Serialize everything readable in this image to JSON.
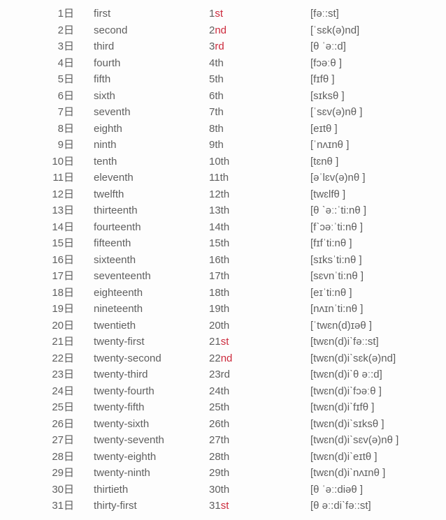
{
  "rows": [
    {
      "day": "1日",
      "word": "first",
      "abbr_pre": "1",
      "abbr_red": "st",
      "abbr_post": "",
      "ipa": "[fəː:st]"
    },
    {
      "day": "2日",
      "word": "second",
      "abbr_pre": "2",
      "abbr_red": "nd",
      "abbr_post": "",
      "ipa": "[ˈsɛk(ə)nd]"
    },
    {
      "day": "3日",
      "word": "third",
      "abbr_pre": "3",
      "abbr_red": "rd",
      "abbr_post": "",
      "ipa": "[θ ˈəː:d]"
    },
    {
      "day": "4日",
      "word": "fourth",
      "abbr_pre": "4th",
      "abbr_red": "",
      "abbr_post": "",
      "ipa": "[fɔəːθ ]"
    },
    {
      "day": "5日",
      "word": "fifth",
      "abbr_pre": "5th",
      "abbr_red": "",
      "abbr_post": "",
      "ipa": "[fɪfθ ]"
    },
    {
      "day": "6日",
      "word": "sixth",
      "abbr_pre": "6th",
      "abbr_red": "",
      "abbr_post": "",
      "ipa": "[sɪksθ ]"
    },
    {
      "day": "7日",
      "word": "seventh",
      "abbr_pre": "7th",
      "abbr_red": "",
      "abbr_post": "",
      "ipa": "[ˈsɛv(ə)nθ ]"
    },
    {
      "day": "8日",
      "word": "eighth",
      "abbr_pre": "8th",
      "abbr_red": "",
      "abbr_post": "",
      "ipa": "[eɪtθ ]"
    },
    {
      "day": "9日",
      "word": "ninth",
      "abbr_pre": "9th",
      "abbr_red": "",
      "abbr_post": "",
      "ipa": "[ˈnʌɪnθ ]"
    },
    {
      "day": "10日",
      "word": "tenth",
      "abbr_pre": "10th",
      "abbr_red": "",
      "abbr_post": "",
      "ipa": "[tɛnθ ]"
    },
    {
      "day": "11日",
      "word": "eleventh",
      "abbr_pre": "11th",
      "abbr_red": "",
      "abbr_post": "",
      "ipa": "[əˈlɛv(ə)nθ ]"
    },
    {
      "day": "12日",
      "word": "twelfth",
      "abbr_pre": "12th",
      "abbr_red": "",
      "abbr_post": "",
      "ipa": "[twɛlfθ ]"
    },
    {
      "day": "13日",
      "word": "thirteenth",
      "abbr_pre": "13th",
      "abbr_red": "",
      "abbr_post": "",
      "ipa": "[θ ˋəː:ˈti:nθ ]"
    },
    {
      "day": "14日",
      "word": "fourteenth",
      "abbr_pre": "14th",
      "abbr_red": "",
      "abbr_post": "",
      "ipa": "[fˋɔəːˈti:nθ ]"
    },
    {
      "day": "15日",
      "word": "fifteenth",
      "abbr_pre": "15th",
      "abbr_red": "",
      "abbr_post": "",
      "ipa": "[fɪfˈti:nθ ]"
    },
    {
      "day": "16日",
      "word": "sixteenth",
      "abbr_pre": "16th",
      "abbr_red": "",
      "abbr_post": "",
      "ipa": "[sɪksˈti:nθ ]"
    },
    {
      "day": "17日",
      "word": "seventeenth",
      "abbr_pre": "17th",
      "abbr_red": "",
      "abbr_post": "",
      "ipa": "[sɛvnˈti:nθ ]"
    },
    {
      "day": "18日",
      "word": "eighteenth",
      "abbr_pre": "18th",
      "abbr_red": "",
      "abbr_post": "",
      "ipa": "[eɪˈti:nθ ]"
    },
    {
      "day": "19日",
      "word": "nineteenth",
      "abbr_pre": "19th",
      "abbr_red": "",
      "abbr_post": "",
      "ipa": "[nʌɪnˈti:nθ ]"
    },
    {
      "day": "20日",
      "word": "twentieth",
      "abbr_pre": "20th",
      "abbr_red": "",
      "abbr_post": "",
      "ipa": "[ˈtwɛn(d)ɪəθ ]"
    },
    {
      "day": "21日",
      "word": "twenty-first",
      "abbr_pre": "21",
      "abbr_red": "st",
      "abbr_post": "",
      "ipa": "[twɛn(d)iˋfəː:st]"
    },
    {
      "day": "22日",
      "word": "twenty-second",
      "abbr_pre": "22",
      "abbr_red": "nd",
      "abbr_post": "",
      "ipa": "[twɛn(d)iˋsɛk(ə)nd]"
    },
    {
      "day": "23日",
      "word": "twenty-third",
      "abbr_pre": "23rd",
      "abbr_red": "",
      "abbr_post": "",
      "ipa": "[twɛn(d)iˋθ əː:d]"
    },
    {
      "day": "24日",
      "word": "twenty-fourth",
      "abbr_pre": "24th",
      "abbr_red": "",
      "abbr_post": "",
      "ipa": "[twɛn(d)iˋfɔəːθ ]"
    },
    {
      "day": "25日",
      "word": "twenty-fifth",
      "abbr_pre": "25th",
      "abbr_red": "",
      "abbr_post": "",
      "ipa": "[twɛn(d)iˋfɪfθ ]"
    },
    {
      "day": "26日",
      "word": "twenty-sixth",
      "abbr_pre": "26th",
      "abbr_red": "",
      "abbr_post": "",
      "ipa": "[twɛn(d)iˋsɪksθ ]"
    },
    {
      "day": "27日",
      "word": "twenty-seventh",
      "abbr_pre": "27th",
      "abbr_red": "",
      "abbr_post": "",
      "ipa": "[twɛn(d)iˋsɛv(ə)nθ ]"
    },
    {
      "day": "28日",
      "word": "twenty-eighth",
      "abbr_pre": "28th",
      "abbr_red": "",
      "abbr_post": "",
      "ipa": "[twɛn(d)iˋeɪtθ ]"
    },
    {
      "day": "29日",
      "word": "twenty-ninth",
      "abbr_pre": "29th",
      "abbr_red": "",
      "abbr_post": "",
      "ipa": "[twɛn(d)iˋnʌɪnθ ]"
    },
    {
      "day": "30日",
      "word": "thirtieth",
      "abbr_pre": "30th",
      "abbr_red": "",
      "abbr_post": "",
      "ipa": "[θ ˈəː:diəθ ]"
    },
    {
      "day": "31日",
      "word": "thirty-first",
      "abbr_pre": "31",
      "abbr_red": "st",
      "abbr_post": "",
      "ipa": "[θ əː:diˋfəː:st]"
    }
  ]
}
